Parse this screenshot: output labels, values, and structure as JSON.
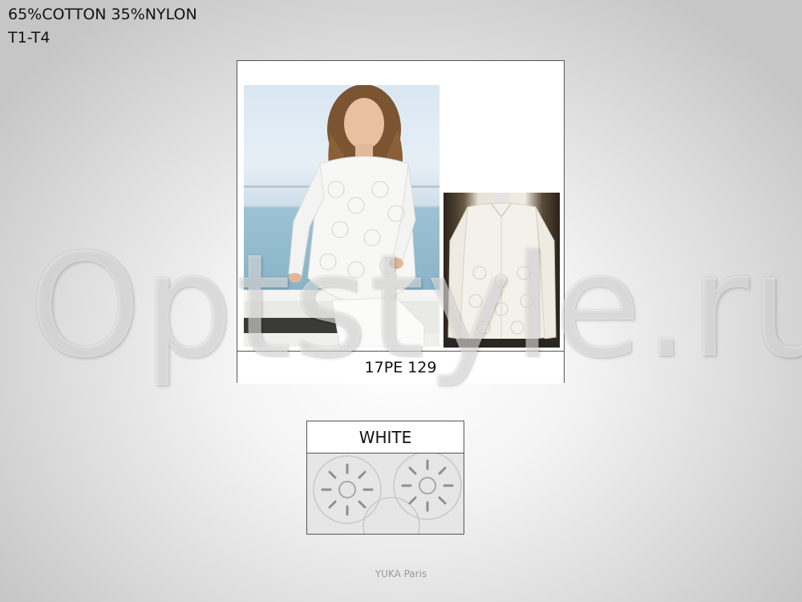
{
  "header": {
    "composition": "65%COTTON 35%NYLON",
    "sizes": "T1-T4"
  },
  "watermark": {
    "text": "Optstyle.ru"
  },
  "product": {
    "style_code": "17PE 129",
    "model_photo": "woman-in-white-lace-shirt-seaside",
    "product_photo": "white-lace-shirt-on-mannequin"
  },
  "color": {
    "name": "WHITE",
    "swatch": "white-floral-eyelet-lace"
  },
  "footer": {
    "brand": "YUKA Paris"
  }
}
